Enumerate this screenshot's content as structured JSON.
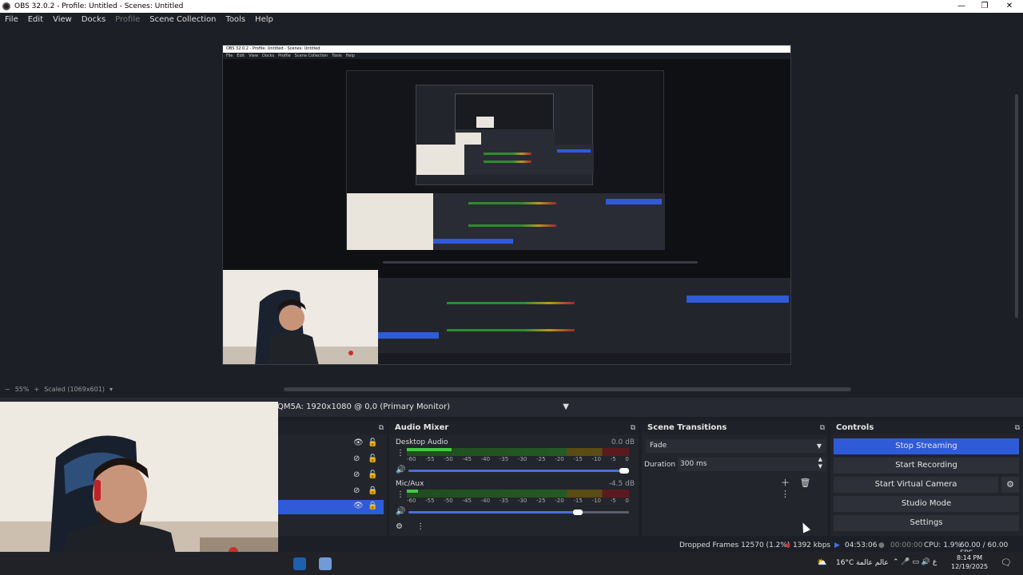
{
  "window": {
    "title": "OBS 32.0.2 - Profile: Untitled - Scenes: Untitled",
    "minimize": "—",
    "restore": "❐",
    "close": "✕"
  },
  "menu": {
    "items": [
      "File",
      "Edit",
      "View",
      "Docks",
      "Profile",
      "Scene Collection",
      "Tools",
      "Help"
    ]
  },
  "preview": {
    "nested_title": "OBS 32.0.2 - Profile: Untitled - Scenes: Untitled",
    "nested_menu": [
      "File",
      "Edit",
      "View",
      "Docks",
      "Profile",
      "Scene Collection",
      "Tools",
      "Help"
    ]
  },
  "zoom": {
    "percent": "55%",
    "scaled": "Scaled (1069x601)"
  },
  "source_selector": {
    "value": "QM5A: 1920x1080 @ 0,0 (Primary Monitor)"
  },
  "mixer": {
    "title": "Audio Mixer",
    "ticks": [
      "-60",
      "-55",
      "-50",
      "-45",
      "-40",
      "-35",
      "-30",
      "-25",
      "-20",
      "-15",
      "-10",
      "-5",
      "0"
    ],
    "channels": [
      {
        "name": "Desktop Audio",
        "db": "0.0 dB",
        "level": 0.2,
        "volume": 1.0
      },
      {
        "name": "Mic/Aux",
        "db": "-4.5 dB",
        "level": 0.05,
        "volume": 0.79
      }
    ]
  },
  "transitions": {
    "title": "Scene Transitions",
    "selected": "Fade",
    "duration_label": "Duration",
    "duration_value": "300 ms"
  },
  "controls": {
    "title": "Controls",
    "stop_streaming": "Stop Streaming",
    "start_recording": "Start Recording",
    "start_virtual_camera": "Start Virtual Camera",
    "studio_mode": "Studio Mode",
    "settings": "Settings"
  },
  "status": {
    "dropped_frames": "Dropped Frames 12570 (1.2%)",
    "bitrate": "1392 kbps",
    "stream_time": "04:53:06",
    "record_time": "00:00:00",
    "cpu": "CPU: 1.9%",
    "fps": "60.00 / 60.00 FPS"
  },
  "taskbar": {
    "weather": "16°C عالم عالمة",
    "time": "8:14 PM",
    "date": "12/19/2025"
  },
  "colors": {
    "accent": "#2f5bd8",
    "background": "#1d1f26",
    "dock": "#23252d"
  }
}
